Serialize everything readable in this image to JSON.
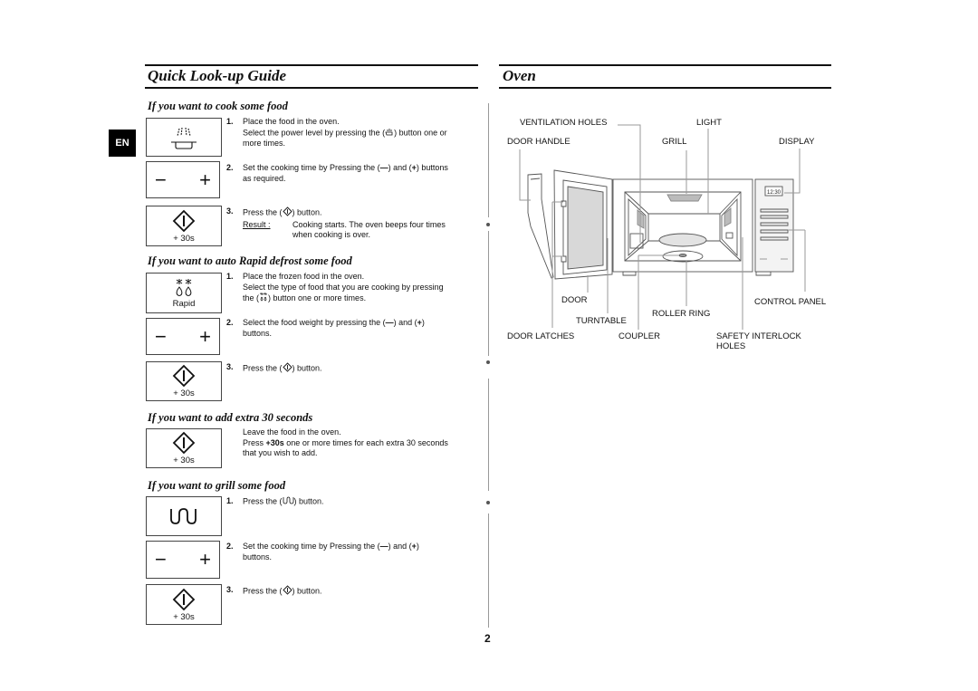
{
  "left": {
    "title": "Quick Look-up Guide",
    "lang_badge": "EN",
    "sections": [
      {
        "heading": "If you want to cook some food",
        "steps": [
          {
            "num": "1.",
            "line1": "Place the food in the oven.",
            "line2a": "Select the power level by pressing the (",
            "line2b": ") button one or",
            "line3": "more times.",
            "icon": "microwave-power-icon"
          },
          {
            "num": "2.",
            "line1a": "Set the cooking time by Pressing the (",
            "line1b": ") and (",
            "line1c": ") buttons",
            "line2": "as required.",
            "icon": "minus-plus-icon"
          },
          {
            "num": "3.",
            "line1a": "Press the (",
            "line1b": ") button.",
            "result_label": "Result :",
            "result_line1": "Cooking starts. The oven beeps four times",
            "result_line2": "when cooking is over.",
            "icon": "start-icon",
            "box_label": "+ 30s"
          }
        ]
      },
      {
        "heading": "If you want to auto Rapid defrost some food",
        "steps": [
          {
            "num": "1.",
            "line1": "Place the frozen food in the oven.",
            "line2": "Select the type of food that you are cooking by pressing",
            "line3a": "the (",
            "line3b": ") button one or more times.",
            "icon": "rapid-defrost-icon",
            "box_label": "Rapid"
          },
          {
            "num": "2.",
            "line1a": "Select the food weight by pressing the (",
            "line1b": ") and (",
            "line1c": ")",
            "line2": "buttons.",
            "icon": "minus-plus-icon"
          },
          {
            "num": "3.",
            "line1a": "Press the (",
            "line1b": ") button.",
            "icon": "start-icon",
            "box_label": "+ 30s"
          }
        ]
      },
      {
        "heading": "If you want to add extra 30 seconds",
        "steps": [
          {
            "line1": "Leave the food in the oven.",
            "line2a": "Press ",
            "line2bold": "+30s",
            "line2b": " one or more times for each extra 30 seconds",
            "line3": "that you wish to add.",
            "icon": "start-icon",
            "box_label": "+ 30s"
          }
        ]
      },
      {
        "heading": "If you want to grill some food",
        "steps": [
          {
            "num": "1.",
            "line1a": "Press the (",
            "line1b": ") button.",
            "icon": "grill-icon"
          },
          {
            "num": "2.",
            "line1a": "Set the cooking time by Pressing the (",
            "line1b": ") and (",
            "line1c": ")",
            "line2": "buttons.",
            "icon": "minus-plus-icon"
          },
          {
            "num": "3.",
            "line1a": "Press the (",
            "line1b": ") button.",
            "icon": "start-icon",
            "box_label": "+ 30s"
          }
        ]
      }
    ]
  },
  "right": {
    "title": "Oven",
    "labels": {
      "ventilation_holes": "VENTILATION HOLES",
      "light": "LIGHT",
      "door_handle": "DOOR HANDLE",
      "grill": "GRILL",
      "display": "DISPLAY",
      "door": "DOOR",
      "control_panel": "CONTROL PANEL",
      "roller_ring": "ROLLER RING",
      "turntable": "TURNTABLE",
      "door_latches": "DOOR LATCHES",
      "coupler": "COUPLER",
      "safety_interlock_1": "SAFETY INTERLOCK",
      "safety_interlock_2": "HOLES"
    },
    "display_readout": "12:30"
  },
  "page_number": "2"
}
